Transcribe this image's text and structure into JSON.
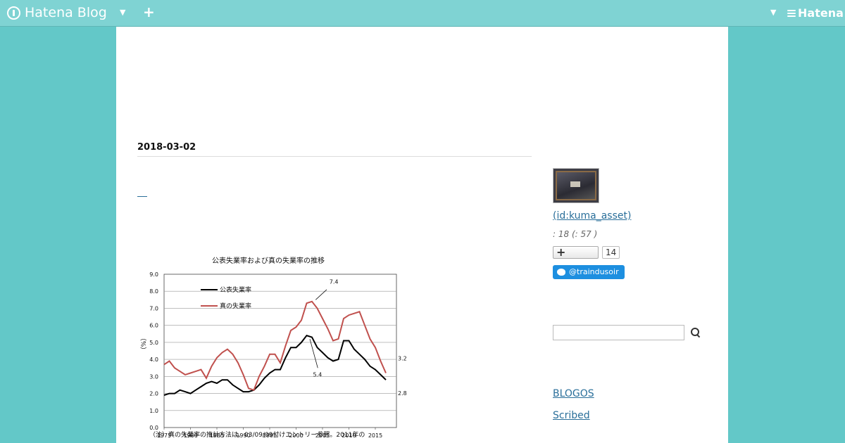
{
  "topbar": {
    "logo_text": "Hatena Blog",
    "dropdown_icon": "chevron-down-icon",
    "add_icon": "plus-icon",
    "brand_text": "Hatena"
  },
  "colors": {
    "background": "#63c8c8",
    "topbar": "#7fd3d3",
    "link": "#2a6f9a",
    "twitter": "#1d8fe0",
    "series_official": "#000000",
    "series_true": "#c0504d"
  },
  "article": {
    "date": "2018-03-02",
    "chart_caption": "（注）真の失業率の推計方法は、03/09/09付けエントリー参照。2011年の"
  },
  "sidebar": {
    "profile_name": " (id:kuma_asset)",
    "profile_stats": ":        18 (:        57 )",
    "follow_count": "14",
    "twitter_label": "@traindusoir",
    "search_placeholder": "",
    "links": [
      "BLOGOS",
      "Scribed"
    ]
  },
  "chart_data": {
    "type": "line",
    "title": "公表失業率および真の失業率の推移",
    "xlabel": "",
    "ylabel": "（%）",
    "ylim": [
      0,
      9
    ],
    "xlim": [
      1975,
      2018
    ],
    "yticks": [
      "0.0",
      "1.0",
      "2.0",
      "3.0",
      "4.0",
      "5.0",
      "6.0",
      "7.0",
      "8.0",
      "9.0"
    ],
    "xticks": [
      "1975",
      "1980",
      "1985",
      "1990",
      "1995",
      "2000",
      "2005",
      "2010",
      "2015"
    ],
    "grid": true,
    "legend_position": "top-left",
    "x": [
      1975,
      1976,
      1977,
      1978,
      1979,
      1980,
      1981,
      1982,
      1983,
      1984,
      1985,
      1986,
      1987,
      1988,
      1989,
      1990,
      1991,
      1992,
      1993,
      1994,
      1995,
      1996,
      1997,
      1998,
      1999,
      2000,
      2001,
      2002,
      2003,
      2004,
      2005,
      2006,
      2007,
      2008,
      2009,
      2010,
      2011,
      2012,
      2013,
      2014,
      2015,
      2016,
      2017
    ],
    "series": [
      {
        "name": "公表失業率",
        "color": "#000000",
        "values": [
          1.9,
          2.0,
          2.0,
          2.2,
          2.1,
          2.0,
          2.2,
          2.4,
          2.6,
          2.7,
          2.6,
          2.8,
          2.8,
          2.5,
          2.3,
          2.1,
          2.1,
          2.2,
          2.5,
          2.9,
          3.2,
          3.4,
          3.4,
          4.1,
          4.7,
          4.7,
          5.0,
          5.4,
          5.3,
          4.7,
          4.4,
          4.1,
          3.9,
          4.0,
          5.1,
          5.1,
          4.6,
          4.3,
          4.0,
          3.6,
          3.4,
          3.1,
          2.8
        ]
      },
      {
        "name": "真の失業率",
        "color": "#c0504d",
        "values": [
          3.7,
          3.9,
          3.5,
          3.3,
          3.1,
          3.2,
          3.3,
          3.4,
          2.9,
          3.6,
          4.1,
          4.4,
          4.6,
          4.3,
          3.8,
          3.1,
          2.3,
          2.2,
          3.0,
          3.6,
          4.3,
          4.3,
          3.8,
          4.8,
          5.7,
          5.9,
          6.3,
          7.3,
          7.4,
          7.0,
          6.4,
          5.8,
          5.1,
          5.2,
          6.4,
          6.6,
          6.7,
          6.8,
          6.0,
          5.2,
          4.7,
          3.9,
          3.2
        ]
      }
    ],
    "annotations": [
      "7.4",
      "5.4",
      "3.2",
      "2.8"
    ]
  }
}
